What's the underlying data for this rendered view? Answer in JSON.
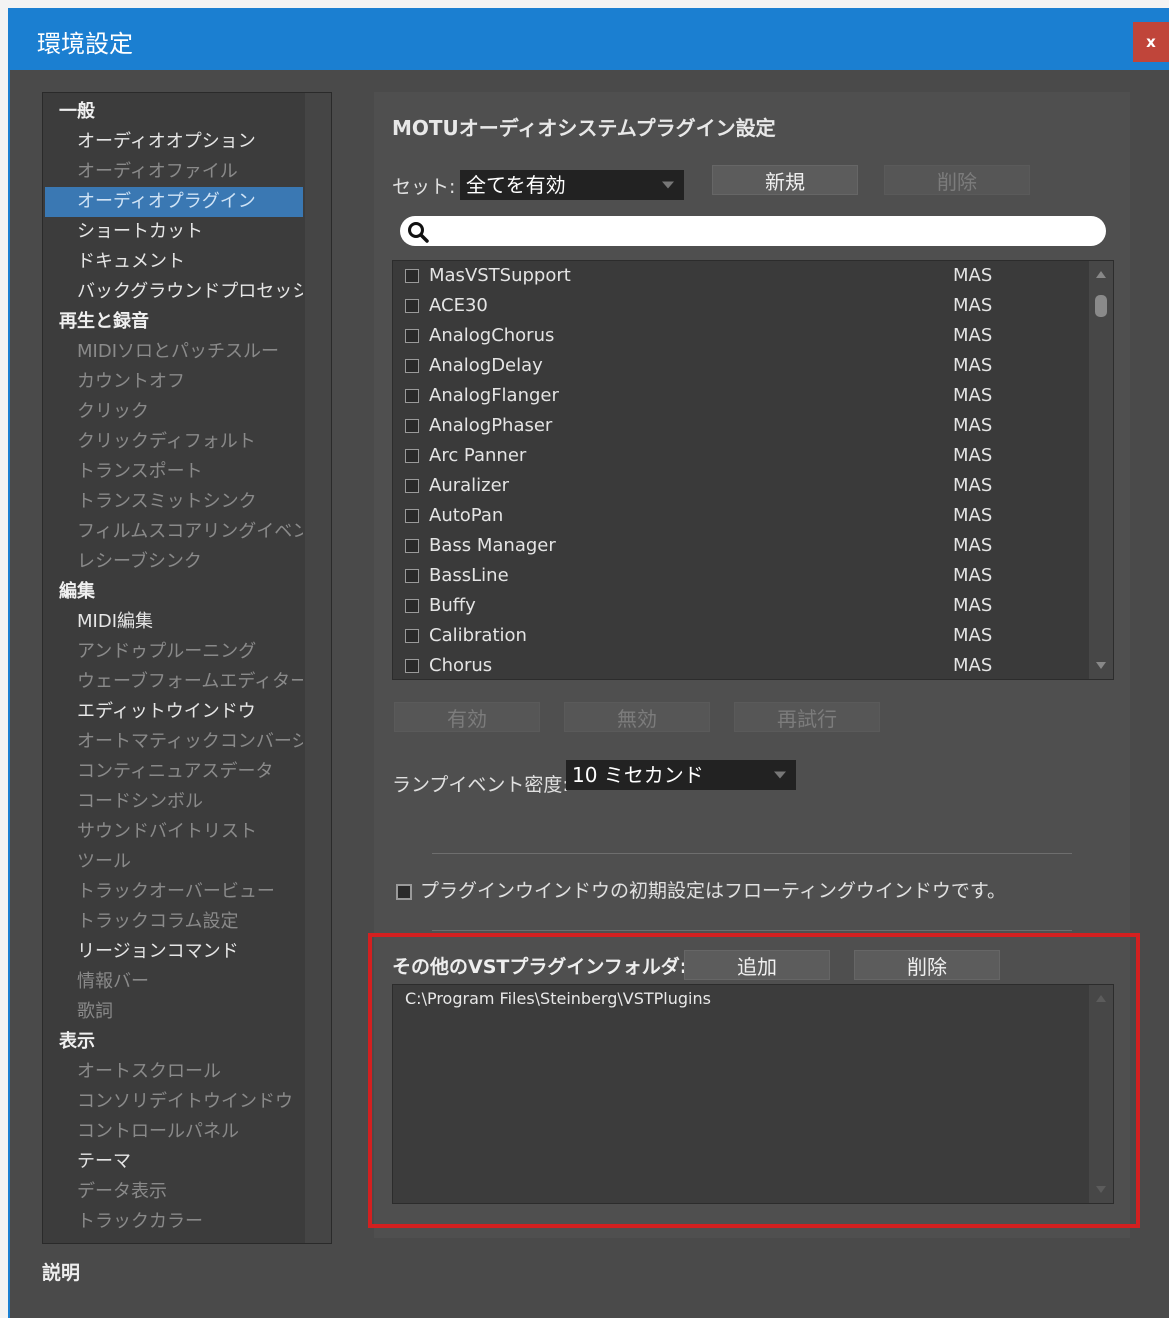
{
  "window": {
    "title": "環境設定",
    "close_label": "x"
  },
  "sidebar": {
    "items": [
      {
        "label": "一般",
        "kind": "cat",
        "dim": false
      },
      {
        "label": "オーディオオプション",
        "kind": "sub",
        "dim": false
      },
      {
        "label": "オーディオファイル",
        "kind": "sub",
        "dim": true
      },
      {
        "label": "オーディオプラグイン",
        "kind": "sub",
        "dim": false,
        "selected": true
      },
      {
        "label": "ショートカット",
        "kind": "sub",
        "dim": false
      },
      {
        "label": "ドキュメント",
        "kind": "sub",
        "dim": false
      },
      {
        "label": "バックグラウンドプロセッシング",
        "kind": "sub",
        "dim": false
      },
      {
        "label": "再生と録音",
        "kind": "cat",
        "dim": false
      },
      {
        "label": "MIDIソロとパッチスルー",
        "kind": "sub",
        "dim": true
      },
      {
        "label": "カウントオフ",
        "kind": "sub",
        "dim": true
      },
      {
        "label": "クリック",
        "kind": "sub",
        "dim": true
      },
      {
        "label": "クリックディフォルト",
        "kind": "sub",
        "dim": true
      },
      {
        "label": "トランスポート",
        "kind": "sub",
        "dim": true
      },
      {
        "label": "トランスミットシンク",
        "kind": "sub",
        "dim": true
      },
      {
        "label": "フィルムスコアリングイベント",
        "kind": "sub",
        "dim": true
      },
      {
        "label": "レシーブシンク",
        "kind": "sub",
        "dim": true
      },
      {
        "label": "編集",
        "kind": "cat",
        "dim": false
      },
      {
        "label": "MIDI編集",
        "kind": "sub",
        "dim": false
      },
      {
        "label": "アンドゥプルーニング",
        "kind": "sub",
        "dim": true
      },
      {
        "label": "ウェーブフォームエディター",
        "kind": "sub",
        "dim": true
      },
      {
        "label": "エディットウインドウ",
        "kind": "sub",
        "dim": false
      },
      {
        "label": "オートマティックコンバージョン",
        "kind": "sub",
        "dim": true
      },
      {
        "label": "コンティニュアスデータ",
        "kind": "sub",
        "dim": true
      },
      {
        "label": "コードシンボル",
        "kind": "sub",
        "dim": true
      },
      {
        "label": "サウンドバイトリスト",
        "kind": "sub",
        "dim": true
      },
      {
        "label": "ツール",
        "kind": "sub",
        "dim": true
      },
      {
        "label": "トラックオーバービュー",
        "kind": "sub",
        "dim": true
      },
      {
        "label": "トラックコラム設定",
        "kind": "sub",
        "dim": true
      },
      {
        "label": "リージョンコマンド",
        "kind": "sub",
        "dim": false
      },
      {
        "label": "情報バー",
        "kind": "sub",
        "dim": true
      },
      {
        "label": "歌詞",
        "kind": "sub",
        "dim": true
      },
      {
        "label": "表示",
        "kind": "cat",
        "dim": false
      },
      {
        "label": "オートスクロール",
        "kind": "sub",
        "dim": true
      },
      {
        "label": "コンソリデイトウインドウ",
        "kind": "sub",
        "dim": true
      },
      {
        "label": "コントロールパネル",
        "kind": "sub",
        "dim": true
      },
      {
        "label": "テーマ",
        "kind": "sub",
        "dim": false
      },
      {
        "label": "データ表示",
        "kind": "sub",
        "dim": true
      },
      {
        "label": "トラックカラー",
        "kind": "sub",
        "dim": true
      }
    ],
    "description_label": "説明"
  },
  "main": {
    "title": "MOTUオーディオシステムプラグイン設定",
    "set_label": "セット:",
    "set_value": "全てを有効",
    "new_button": "新規",
    "delete_set_button": "削除",
    "search_placeholder": "",
    "plugins": [
      {
        "name": "MasVSTSupport",
        "type": "MAS"
      },
      {
        "name": "ACE30",
        "type": "MAS"
      },
      {
        "name": "AnalogChorus",
        "type": "MAS"
      },
      {
        "name": "AnalogDelay",
        "type": "MAS"
      },
      {
        "name": "AnalogFlanger",
        "type": "MAS"
      },
      {
        "name": "AnalogPhaser",
        "type": "MAS"
      },
      {
        "name": "Arc Panner",
        "type": "MAS"
      },
      {
        "name": "Auralizer",
        "type": "MAS"
      },
      {
        "name": "AutoPan",
        "type": "MAS"
      },
      {
        "name": "Bass Manager",
        "type": "MAS"
      },
      {
        "name": "BassLine",
        "type": "MAS"
      },
      {
        "name": "Buffy",
        "type": "MAS"
      },
      {
        "name": "Calibration",
        "type": "MAS"
      },
      {
        "name": "Chorus",
        "type": "MAS"
      }
    ],
    "enable_button": "有効",
    "disable_button": "無効",
    "retry_button": "再試行",
    "lamp_label": "ランプイベント密度:",
    "lamp_value": "10 ミセカンド",
    "floating_checkbox_label": "プラグインウインドウの初期設定はフローティングウインドウです。",
    "vst_folder_label": "その他のVSTプラグインフォルダ:",
    "vst_add_button": "追加",
    "vst_delete_button": "削除",
    "vst_folders": [
      "C:\\Program Files\\Steinberg\\VSTPlugins"
    ]
  },
  "colors": {
    "accent": "#1b7fd1",
    "highlight": "#d32020",
    "panel_bg": "#4a4a4a"
  }
}
